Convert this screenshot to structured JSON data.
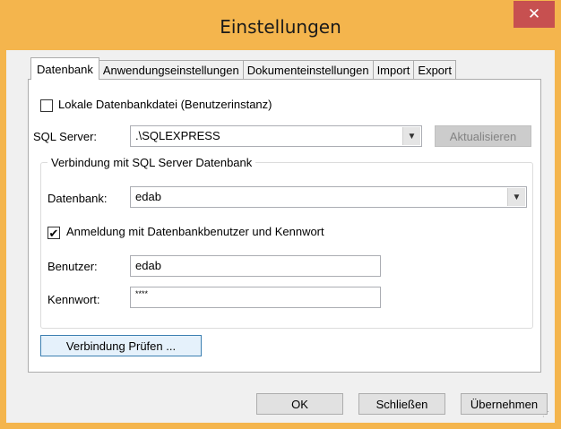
{
  "window": {
    "title": "Einstellungen",
    "close_glyph": "✕"
  },
  "tabs": [
    "Datenbank",
    "Anwendungseinstellungen",
    "Dokumenteinstellungen",
    "Import",
    "Export"
  ],
  "local_db": {
    "label": "Lokale Datenbankdatei (Benutzerinstanz)",
    "checked": false
  },
  "sql_server": {
    "label": "SQL Server:",
    "value": ".\\SQLEXPRESS",
    "refresh_label": "Aktualisieren"
  },
  "connection_group": {
    "legend": "Verbindung mit SQL Server Datenbank",
    "database_label": "Datenbank:",
    "database_value": "edab",
    "auth_label": "Anmeldung mit  Datenbankbenutzer und Kennwort",
    "auth_checked": true,
    "check_glyph": "✔",
    "user_label": "Benutzer:",
    "user_value": "edab",
    "password_label": "Kennwort:",
    "password_value": "****"
  },
  "test_button": "Verbindung Prüfen ...",
  "footer": {
    "ok": "OK",
    "close": "Schließen",
    "apply": "Übernehmen"
  },
  "icons": {
    "dropdown": "chevron-down-icon",
    "close": "close-icon",
    "check": "check-icon"
  }
}
